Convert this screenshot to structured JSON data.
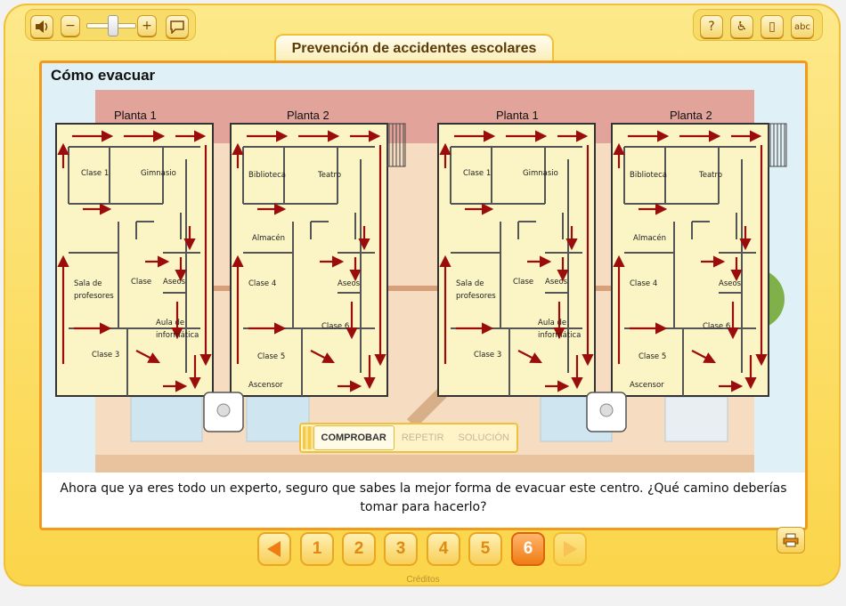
{
  "toolbar": {
    "sound_icon": "speaker-icon",
    "minus_label": "−",
    "plus_label": "+",
    "right_buttons": [
      "?",
      "♿",
      "▯",
      "abc"
    ]
  },
  "title": "Prevención de accidentes escolares",
  "activity": {
    "heading": "Cómo evacuar",
    "plans": [
      {
        "floor": "Planta 1",
        "rooms": [
          "Clase 1",
          "Gimnasio",
          "Sala de",
          "profesores",
          "Clase",
          "Aseos",
          "Aula de",
          "informática",
          "Clase 3"
        ]
      },
      {
        "floor": "Planta 2",
        "rooms": [
          "Biblioteca",
          "Teatro",
          "Almacén",
          "Clase 4",
          "Aseos",
          "Clase 6",
          "Clase 5",
          "Ascensor"
        ]
      },
      {
        "floor": "Planta 1",
        "rooms": [
          "Clase 1",
          "Gimnasio",
          "Sala de",
          "profesores",
          "Clase",
          "Aseos",
          "Aula de",
          "informática",
          "Clase 3"
        ]
      },
      {
        "floor": "Planta 2",
        "rooms": [
          "Biblioteca",
          "Teatro",
          "Almacén",
          "Clase 4",
          "Aseos",
          "Clase 6",
          "Clase 5",
          "Ascensor"
        ]
      }
    ],
    "controls": {
      "check": "COMPROBAR",
      "repeat": "REPETIR",
      "solution": "SOLUCIÓN"
    },
    "question": "Ahora que ya eres todo un experto, seguro que sabes la mejor forma de evacuar este centro. ¿Qué camino deberías tomar para hacerlo?"
  },
  "pagination": {
    "pages": [
      "1",
      "2",
      "3",
      "4",
      "5",
      "6"
    ],
    "current": "6"
  },
  "footer": {
    "credits": "Créditos"
  },
  "colors": {
    "accent": "#f29a1a",
    "arrow": "#9b0d0d",
    "plan_bg": "#fbf4c4",
    "frame": "#fbd54a"
  }
}
